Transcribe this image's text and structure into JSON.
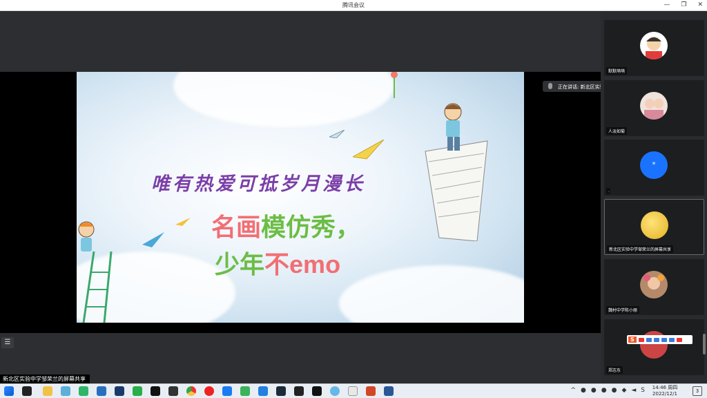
{
  "window": {
    "title": "腾讯会议"
  },
  "slide": {
    "slogan": "唯有热爱可抵岁月漫长",
    "line1": [
      "名画",
      "模仿秀，"
    ],
    "line2": [
      "少年",
      "不",
      "emo"
    ]
  },
  "speaking": {
    "text": "正在讲话: 新北区实验中学..."
  },
  "participants": [
    {
      "name": "默默萌萌"
    },
    {
      "name": "人淡如菊"
    },
    {
      "name": "*"
    },
    {
      "name": "新北区实验中学邹荣兰的屏幕共享"
    },
    {
      "name": "魏村中学陈小丽"
    },
    {
      "name": "郑志东"
    }
  ],
  "share_label": "新北区实验中学邹荣兰的屏幕共享",
  "taskbar": {
    "time": "14:46 周四",
    "date": "2022/12/1",
    "notifications": "3"
  },
  "colors": {
    "slogan": "#7b3fa8",
    "pink": "#f16f74",
    "green": "#6cbd45",
    "avatar_blue": "#1a73ff"
  }
}
